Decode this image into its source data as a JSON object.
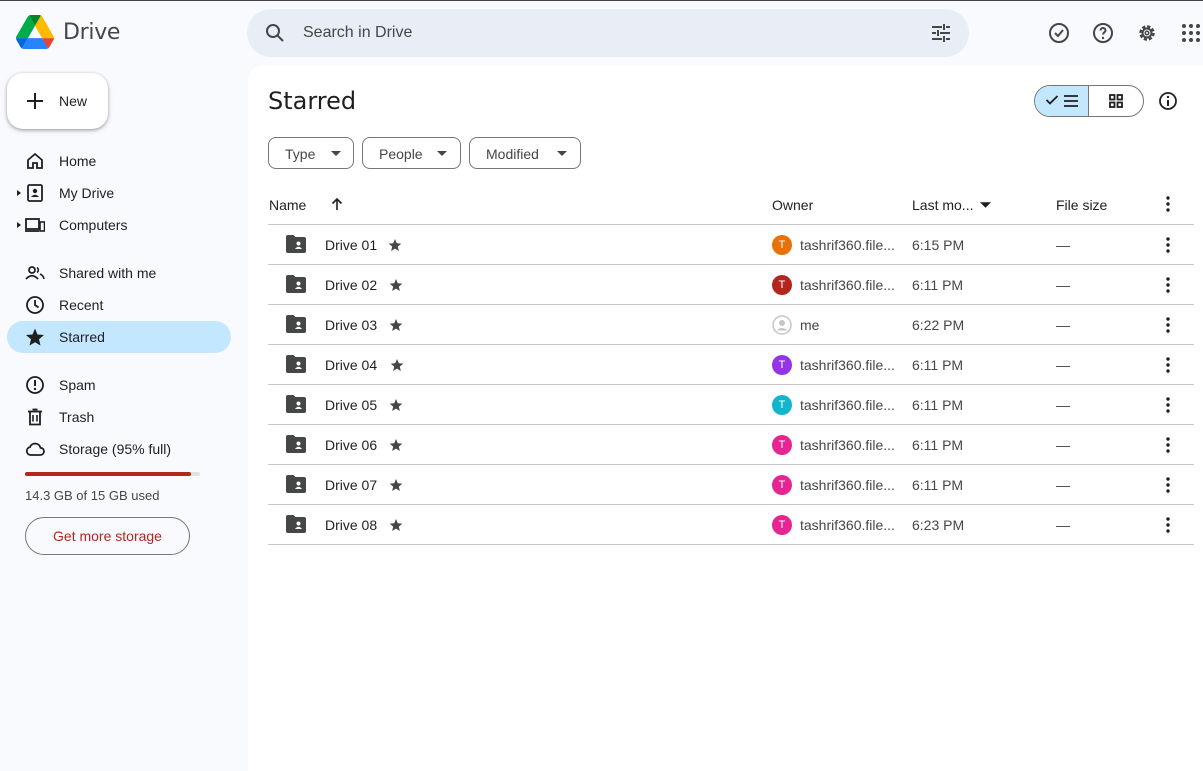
{
  "app": {
    "name": "Drive"
  },
  "search": {
    "placeholder": "Search in Drive"
  },
  "sidebar": {
    "new_label": "New",
    "items": [
      {
        "label": "Home",
        "icon": "home-icon"
      },
      {
        "label": "My Drive",
        "icon": "my-drive-icon"
      },
      {
        "label": "Computers",
        "icon": "computers-icon"
      },
      {
        "label": "Shared with me",
        "icon": "shared-icon"
      },
      {
        "label": "Recent",
        "icon": "clock-icon"
      },
      {
        "label": "Starred",
        "icon": "star-icon",
        "active": true
      },
      {
        "label": "Spam",
        "icon": "spam-icon"
      },
      {
        "label": "Trash",
        "icon": "trash-icon"
      },
      {
        "label": "Storage (95% full)",
        "icon": "cloud-icon"
      }
    ],
    "storage": {
      "used_text": "14.3 GB of 15 GB used",
      "percent_full": 95,
      "button": "Get more storage"
    }
  },
  "main": {
    "title": "Starred",
    "filters": [
      "Type",
      "People",
      "Modified"
    ],
    "columns": {
      "name": "Name",
      "owner": "Owner",
      "modified": "Last mo...",
      "size": "File size"
    },
    "rows": [
      {
        "name": "Drive 01",
        "owner": "tashrif360.file...",
        "avatar": "T",
        "avatar_color": "#e8710a",
        "modified": "6:15 PM",
        "size": "—"
      },
      {
        "name": "Drive 02",
        "owner": "tashrif360.file...",
        "avatar": "T",
        "avatar_color": "#b3261e",
        "modified": "6:11 PM",
        "size": "—"
      },
      {
        "name": "Drive 03",
        "owner": "me",
        "avatar": "",
        "avatar_color": "#c4c7c5",
        "modified": "6:22 PM",
        "size": "—"
      },
      {
        "name": "Drive 04",
        "owner": "tashrif360.file...",
        "avatar": "T",
        "avatar_color": "#9334e6",
        "modified": "6:11 PM",
        "size": "—"
      },
      {
        "name": "Drive 05",
        "owner": "tashrif360.file...",
        "avatar": "T",
        "avatar_color": "#12b5cb",
        "modified": "6:11 PM",
        "size": "—"
      },
      {
        "name": "Drive 06",
        "owner": "tashrif360.file...",
        "avatar": "T",
        "avatar_color": "#e52592",
        "modified": "6:11 PM",
        "size": "—"
      },
      {
        "name": "Drive 07",
        "owner": "tashrif360.file...",
        "avatar": "T",
        "avatar_color": "#e52592",
        "modified": "6:11 PM",
        "size": "—"
      },
      {
        "name": "Drive 08",
        "owner": "tashrif360.file...",
        "avatar": "T",
        "avatar_color": "#e52592",
        "modified": "6:23 PM",
        "size": "—"
      }
    ]
  }
}
